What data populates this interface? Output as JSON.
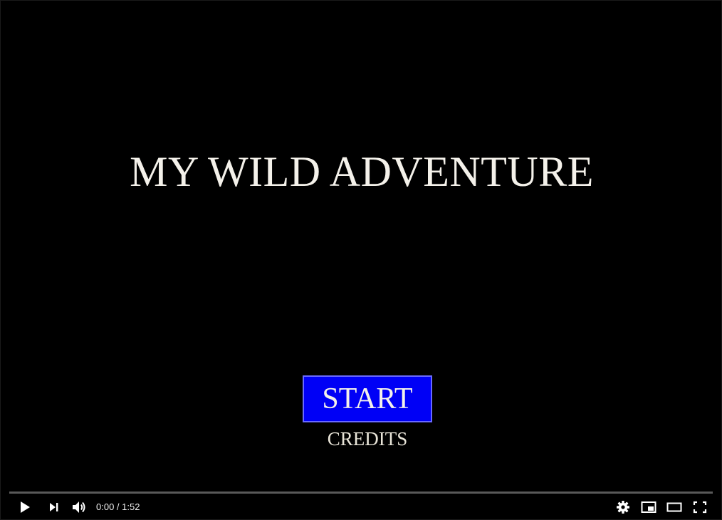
{
  "game": {
    "title": "MY WILD ADVENTURE",
    "menu": {
      "start_label": "START",
      "credits_label": "CREDITS"
    },
    "colors": {
      "background": "#000000",
      "start_button": "#0000f6",
      "text": "#f4f1ea"
    }
  },
  "player": {
    "current_time": "0:00",
    "separator": " / ",
    "duration": "1:52",
    "progress_fraction": 0,
    "controls": {
      "left": [
        "play-icon",
        "next-icon",
        "volume-icon"
      ],
      "right": [
        "settings-icon",
        "miniplayer-icon",
        "theater-icon",
        "fullscreen-icon"
      ]
    },
    "colors": {
      "progress_played": "#ff0000",
      "icon": "#ffffff"
    }
  }
}
